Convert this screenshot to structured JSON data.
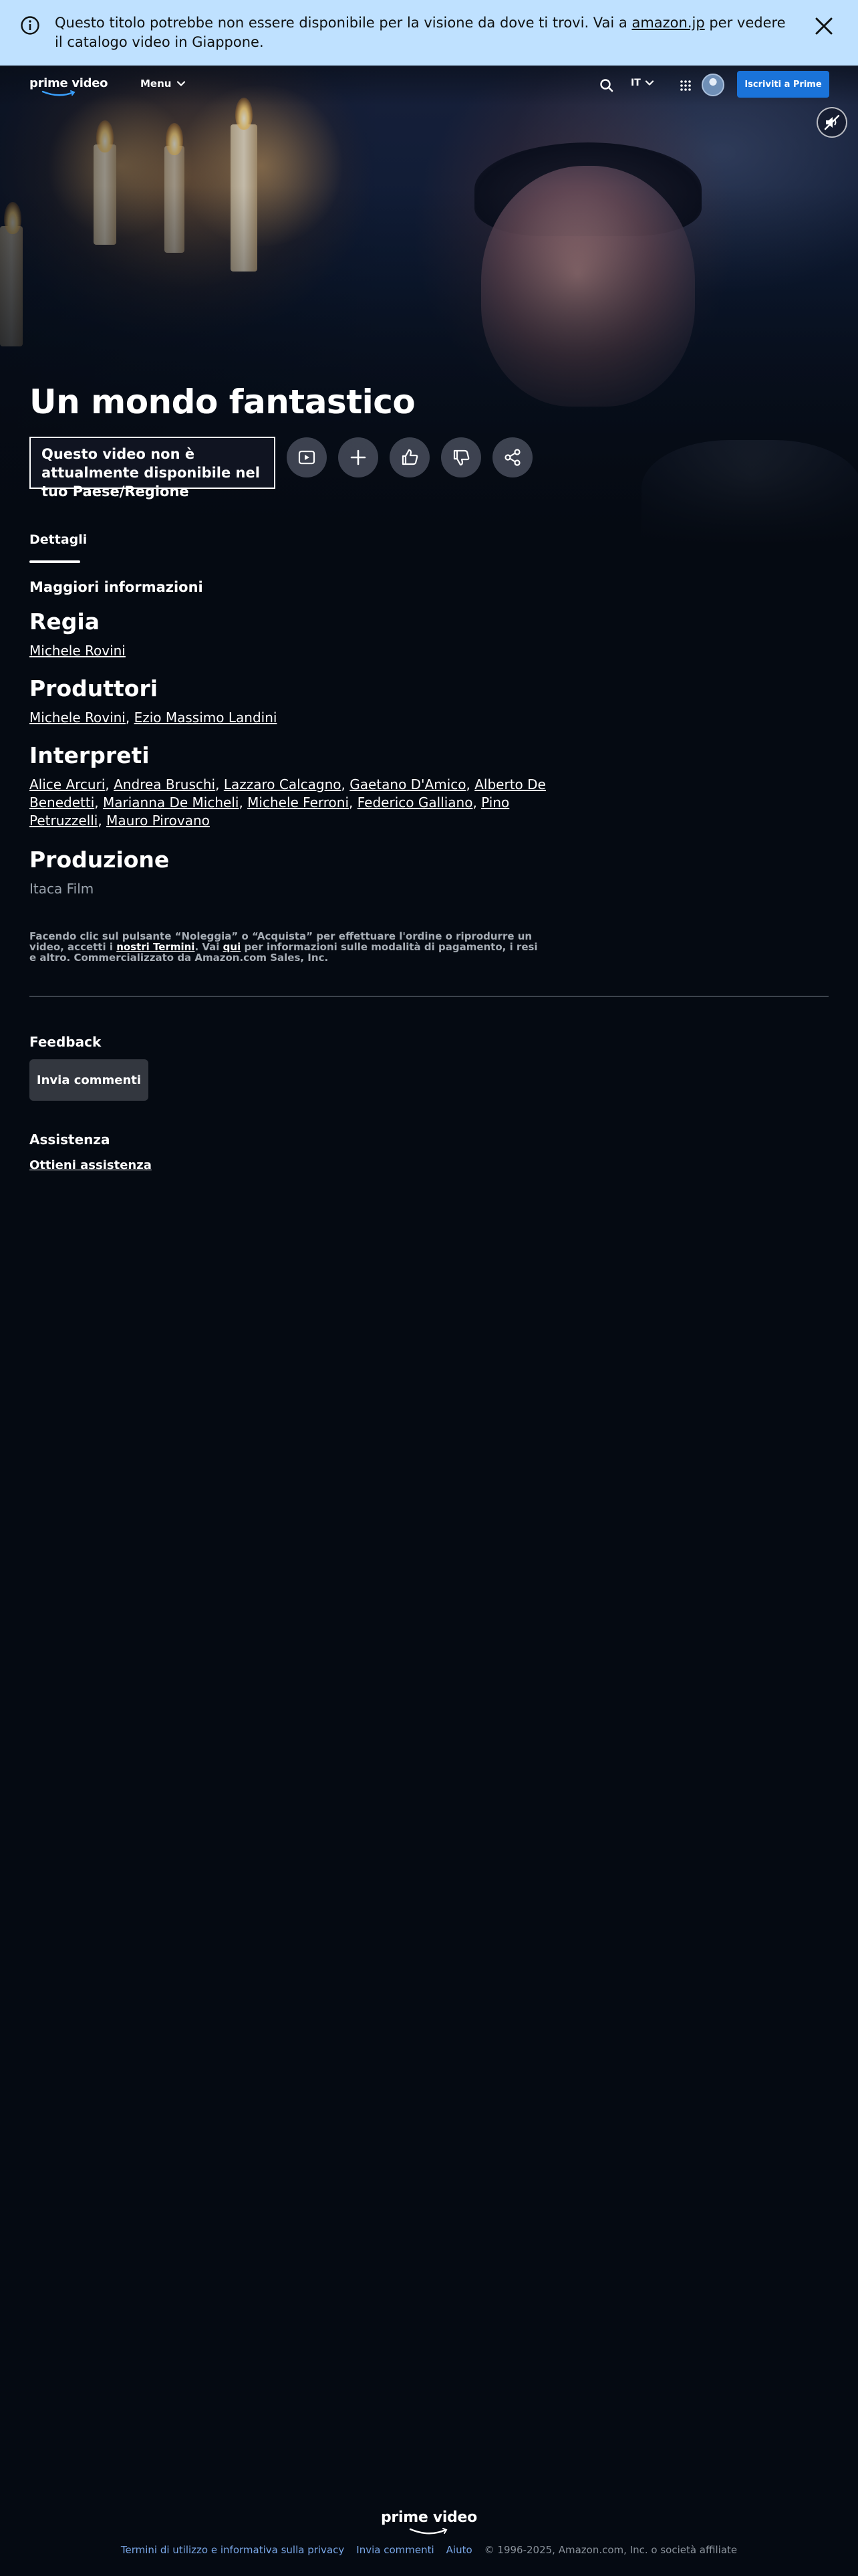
{
  "notice": {
    "text_before": "Questo titolo potrebbe non essere disponibile per la visione da dove ti trovi. Vai a ",
    "link": "amazon.jp",
    "text_after": " per vedere il catalogo video in Giappone."
  },
  "nav": {
    "logo": "prime video",
    "menu_label": "Menu",
    "language": "IT",
    "join_prime": "Iscriviti a Prime"
  },
  "title": "Un mondo fantastico",
  "unavailable_text": "Questo video non è attualmente disponibile nel tuo Paese/Regione",
  "tabs": {
    "details": "Dettagli"
  },
  "more_info": "Maggiori informazioni",
  "sections": {
    "direction": {
      "heading": "Regia",
      "names": [
        "Michele Rovini"
      ]
    },
    "producers": {
      "heading": "Produttori",
      "names": [
        "Michele Rovini",
        "Ezio Massimo Landini"
      ]
    },
    "cast": {
      "heading": "Interpreti",
      "names": [
        "Alice Arcuri",
        "Andrea Bruschi",
        "Lazzaro Calcagno",
        "Gaetano D'Amico",
        "Alberto De Benedetti",
        "Marianna De Micheli",
        "Michele Ferroni",
        "Federico Galliano",
        "Pino Petruzzelli",
        "Mauro Pirovano"
      ]
    },
    "production": {
      "heading": "Produzione",
      "value": "Itaca Film"
    }
  },
  "legal": {
    "part1": "Facendo clic sul pulsante “Noleggia” o “Acquista” per effettuare l'ordine o riprodurre un video, accetti i ",
    "terms_link": "nostri Termini",
    "part2": ". Vai ",
    "here_link": "qui",
    "part3": " per informazioni sulle modalità di pagamento, i resi e altro. Commercializzato da Amazon.com Sales, Inc."
  },
  "feedback": {
    "heading": "Feedback",
    "button": "Invia commenti"
  },
  "assistance": {
    "heading": "Assistenza",
    "link": "Ottieni assistenza"
  },
  "footer": {
    "logo": "prime video",
    "links": [
      "Termini di utilizzo e informativa sulla privacy",
      "Invia commenti",
      "Aiuto"
    ],
    "copyright": "© 1996-2025, Amazon.com, Inc. o società affiliate"
  },
  "colors": {
    "banner": "#bfe1ff",
    "prime_blue": "#1a73d9",
    "background": "#050a12",
    "footer_link": "#79a6e6"
  },
  "icons": [
    "info-icon",
    "close-icon",
    "search-icon",
    "chevron-down-icon",
    "apps-grid-icon",
    "avatar",
    "mute-icon",
    "trailer-icon",
    "plus-icon",
    "thumbs-up-icon",
    "thumbs-down-icon",
    "share-icon",
    "smile-logo-icon"
  ]
}
